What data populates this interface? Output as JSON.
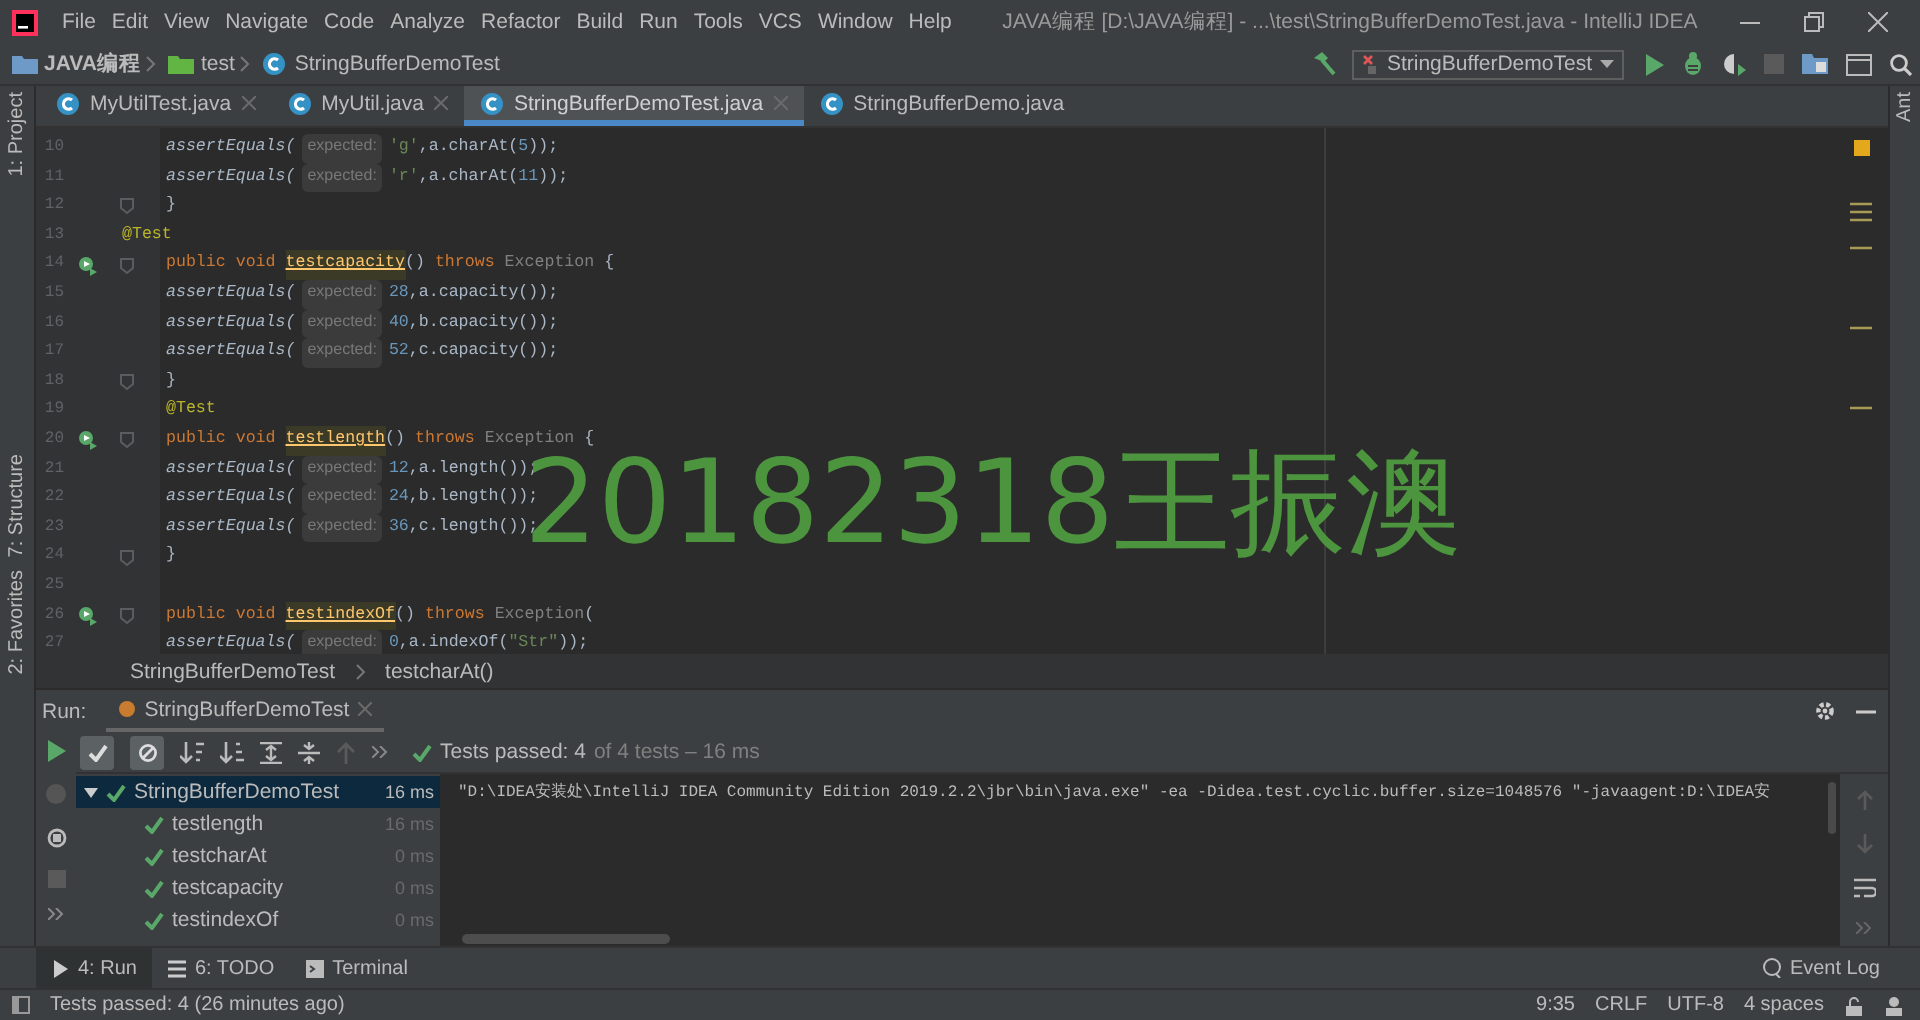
{
  "title_bar": {
    "menus": [
      "File",
      "Edit",
      "View",
      "Navigate",
      "Code",
      "Analyze",
      "Refactor",
      "Build",
      "Run",
      "Tools",
      "VCS",
      "Window",
      "Help"
    ],
    "title": "JAVA编程 [D:\\JAVA编程] - ...\\test\\StringBufferDemoTest.java - IntelliJ IDEA"
  },
  "nav_bar": {
    "breadcrumbs": [
      {
        "kind": "project",
        "label": "JAVA编程"
      },
      {
        "kind": "folder",
        "label": "test"
      },
      {
        "kind": "class",
        "label": "StringBufferDemoTest"
      }
    ],
    "run_config": "StringBufferDemoTest"
  },
  "side_tabs_left": [
    "1: Project",
    "7: Structure",
    "2: Favorites"
  ],
  "side_tabs_right": [
    "Ant"
  ],
  "tabs": [
    {
      "label": "MyUtilTest.java",
      "selected": false
    },
    {
      "label": "MyUtil.java",
      "selected": false
    },
    {
      "label": "StringBufferDemoTest.java",
      "selected": true
    },
    {
      "label": "StringBufferDemo.java",
      "selected": false
    }
  ],
  "editor": {
    "lines": [
      {
        "number": "10",
        "run": false,
        "fold": false,
        "outdent": false,
        "tokens": [
          {
            "kind": "call",
            "text": "assertEquals("
          },
          {
            "kind": "hint",
            "text": "expected:"
          },
          {
            "kind": "string",
            "text": "'g'"
          },
          {
            "kind": "plain",
            "text": ",a.charAt("
          },
          {
            "kind": "number",
            "text": "5"
          },
          {
            "kind": "plain",
            "text": "));"
          }
        ]
      },
      {
        "number": "11",
        "run": false,
        "fold": false,
        "outdent": false,
        "tokens": [
          {
            "kind": "call",
            "text": "assertEquals("
          },
          {
            "kind": "hint",
            "text": "expected:"
          },
          {
            "kind": "string",
            "text": "'r'"
          },
          {
            "kind": "plain",
            "text": ",a.charAt("
          },
          {
            "kind": "number",
            "text": "11"
          },
          {
            "kind": "plain",
            "text": "));"
          }
        ]
      },
      {
        "number": "12",
        "run": false,
        "fold": true,
        "outdent": false,
        "tokens": [
          {
            "kind": "plain",
            "text": "}"
          }
        ]
      },
      {
        "number": "13",
        "run": false,
        "fold": false,
        "outdent": true,
        "tokens": [
          {
            "kind": "annotation",
            "text": "@Test"
          }
        ]
      },
      {
        "number": "14",
        "run": true,
        "fold": true,
        "outdent": false,
        "tokens": [
          {
            "kind": "keyword",
            "text": "public void "
          },
          {
            "kind": "decl",
            "text": "testcapacity"
          },
          {
            "kind": "plain",
            "text": "() "
          },
          {
            "kind": "keyword",
            "text": "throws "
          },
          {
            "kind": "muted",
            "text": "Exception"
          },
          {
            "kind": "plain",
            "text": " {"
          }
        ]
      },
      {
        "number": "15",
        "run": false,
        "fold": false,
        "outdent": false,
        "tokens": [
          {
            "kind": "call",
            "text": "assertEquals("
          },
          {
            "kind": "hint",
            "text": "expected:"
          },
          {
            "kind": "number",
            "text": "28"
          },
          {
            "kind": "plain",
            "text": ",a.capacity());"
          }
        ]
      },
      {
        "number": "16",
        "run": false,
        "fold": false,
        "outdent": false,
        "tokens": [
          {
            "kind": "call",
            "text": "assertEquals("
          },
          {
            "kind": "hint",
            "text": "expected:"
          },
          {
            "kind": "number",
            "text": "40"
          },
          {
            "kind": "plain",
            "text": ",b.capacity());"
          }
        ]
      },
      {
        "number": "17",
        "run": false,
        "fold": false,
        "outdent": false,
        "tokens": [
          {
            "kind": "call",
            "text": "assertEquals("
          },
          {
            "kind": "hint",
            "text": "expected:"
          },
          {
            "kind": "number",
            "text": "52"
          },
          {
            "kind": "plain",
            "text": ",c.capacity());"
          }
        ]
      },
      {
        "number": "18",
        "run": false,
        "fold": true,
        "outdent": false,
        "tokens": [
          {
            "kind": "plain",
            "text": "}"
          }
        ]
      },
      {
        "number": "19",
        "run": false,
        "fold": false,
        "outdent": false,
        "tokens": [
          {
            "kind": "annotation",
            "text": "@Test"
          }
        ]
      },
      {
        "number": "20",
        "run": true,
        "fold": true,
        "outdent": false,
        "tokens": [
          {
            "kind": "keyword",
            "text": "public void "
          },
          {
            "kind": "decl",
            "text": "testlength"
          },
          {
            "kind": "plain",
            "text": "() "
          },
          {
            "kind": "keyword",
            "text": "throws "
          },
          {
            "kind": "muted",
            "text": "Exception"
          },
          {
            "kind": "plain",
            "text": " {"
          }
        ]
      },
      {
        "number": "21",
        "run": false,
        "fold": false,
        "outdent": false,
        "tokens": [
          {
            "kind": "call",
            "text": "assertEquals("
          },
          {
            "kind": "hint",
            "text": "expected:"
          },
          {
            "kind": "number",
            "text": "12"
          },
          {
            "kind": "plain",
            "text": ",a.length());"
          }
        ]
      },
      {
        "number": "22",
        "run": false,
        "fold": false,
        "outdent": false,
        "tokens": [
          {
            "kind": "call",
            "text": "assertEquals("
          },
          {
            "kind": "hint",
            "text": "expected:"
          },
          {
            "kind": "number",
            "text": "24"
          },
          {
            "kind": "plain",
            "text": ",b.length());"
          }
        ]
      },
      {
        "number": "23",
        "run": false,
        "fold": false,
        "outdent": false,
        "tokens": [
          {
            "kind": "call",
            "text": "assertEquals("
          },
          {
            "kind": "hint",
            "text": "expected:"
          },
          {
            "kind": "number",
            "text": "36"
          },
          {
            "kind": "plain",
            "text": ",c.length());"
          }
        ]
      },
      {
        "number": "24",
        "run": false,
        "fold": true,
        "outdent": false,
        "tokens": [
          {
            "kind": "plain",
            "text": "}"
          }
        ]
      },
      {
        "number": "25",
        "run": false,
        "fold": false,
        "outdent": false
      },
      {
        "number": "26",
        "run": true,
        "fold": true,
        "outdent": false,
        "tokens": [
          {
            "kind": "keyword",
            "text": "public void "
          },
          {
            "kind": "decl",
            "text": "testindexOf"
          },
          {
            "kind": "plain",
            "text": "() "
          },
          {
            "kind": "keyword",
            "text": "throws "
          },
          {
            "kind": "muted",
            "text": "Exception"
          },
          {
            "kind": "plain",
            "text": "("
          }
        ]
      },
      {
        "number": "27",
        "run": false,
        "fold": false,
        "outdent": false,
        "tokens": [
          {
            "kind": "call",
            "text": "assertEquals("
          },
          {
            "kind": "hint",
            "text": "expected:"
          },
          {
            "kind": "number",
            "text": "0"
          },
          {
            "kind": "plain",
            "text": ",a.indexOf("
          },
          {
            "kind": "string",
            "text": "\"Str\""
          },
          {
            "kind": "plain",
            "text": "));"
          }
        ]
      }
    ],
    "overlay_text": "20182318王振澳",
    "breadcrumbs": [
      "StringBufferDemoTest",
      "testcharAt()"
    ]
  },
  "run_panel": {
    "label": "Run:",
    "tab": "StringBufferDemoTest",
    "toggles": [
      {
        "kind": "passed",
        "on": true
      },
      {
        "kind": "ignored",
        "on": true
      }
    ],
    "summary": {
      "passed": "Tests passed: 4",
      "detail": "of 4 tests – 16 ms"
    },
    "tree": {
      "label": "StringBufferDemoTest",
      "time": "16 ms",
      "passed": true,
      "expanded": true,
      "selected": true,
      "children": [
        {
          "label": "testlength",
          "time": "16 ms",
          "passed": true,
          "selected": false
        },
        {
          "label": "testcharAt",
          "time": "0 ms",
          "passed": true,
          "selected": false
        },
        {
          "label": "testcapacity",
          "time": "0 ms",
          "passed": true,
          "selected": false
        },
        {
          "label": "testindexOf",
          "time": "0 ms",
          "passed": true,
          "selected": false
        }
      ]
    },
    "console": "\"D:\\IDEA安装处\\IntelliJ IDEA Community Edition 2019.2.2\\jbr\\bin\\java.exe\" -ea -Didea.test.cyclic.buffer.size=1048576 \"-javaagent:D:\\IDEA安"
  },
  "tool_windows": [
    {
      "label": "4: Run",
      "kind": "run",
      "selected": true
    },
    {
      "label": "6: TODO",
      "kind": "todo",
      "selected": false
    },
    {
      "label": "Terminal",
      "kind": "terminal",
      "selected": false
    }
  ],
  "event_log": "Event Log",
  "status_bar": {
    "message": "Tests passed: 4 (26 minutes ago)",
    "position": "9:35",
    "line_separator": "CRLF",
    "encoding": "UTF-8",
    "indent": "4 spaces"
  }
}
